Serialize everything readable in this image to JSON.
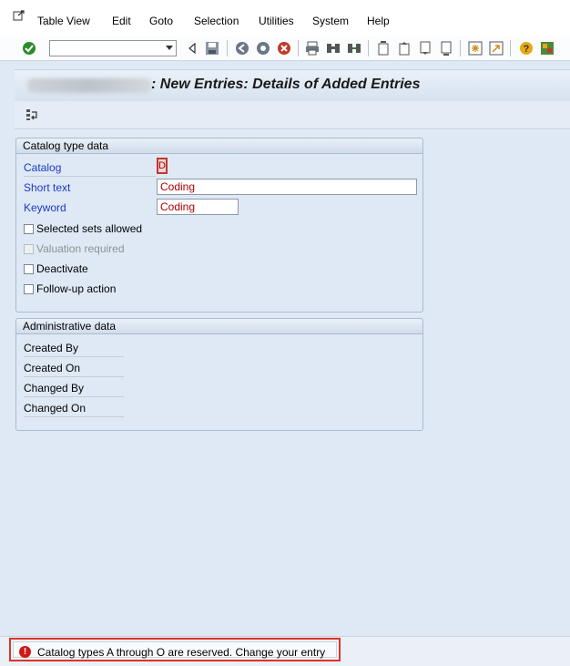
{
  "menubar": {
    "items": [
      {
        "label": "Table View"
      },
      {
        "label": "Edit"
      },
      {
        "label": "Goto"
      },
      {
        "label": "Selection"
      },
      {
        "label": "Utilities"
      },
      {
        "label": "System"
      },
      {
        "label": "Help"
      }
    ]
  },
  "toolbar": {
    "command_field_value": ""
  },
  "title": {
    "text": ": New Entries: Details of Added Entries"
  },
  "catalog_group": {
    "header": "Catalog type data",
    "catalog_label": "Catalog",
    "catalog_value": "D",
    "short_text_label": "Short text",
    "short_text_value": "Coding",
    "keyword_label": "Keyword",
    "keyword_value": "Coding",
    "checkboxes": [
      {
        "label": "Selected sets allowed",
        "checked": false,
        "disabled": false
      },
      {
        "label": "Valuation required",
        "checked": false,
        "disabled": true
      },
      {
        "label": "Deactivate",
        "checked": false,
        "disabled": false
      },
      {
        "label": "Follow-up action",
        "checked": false,
        "disabled": false
      }
    ]
  },
  "admin_group": {
    "header": "Administrative data",
    "fields": [
      {
        "label": "Created By"
      },
      {
        "label": "Created On"
      },
      {
        "label": "Changed By"
      },
      {
        "label": "Changed On"
      }
    ]
  },
  "statusbar": {
    "message": "Catalog types A through O are reserved. Change your entry",
    "icon": "error-icon",
    "icon_symbol": "!"
  },
  "colors": {
    "required_label": "#1b38c6",
    "input_text": "#b00000",
    "error_border": "#d9342b",
    "error_icon": "#d11818"
  }
}
